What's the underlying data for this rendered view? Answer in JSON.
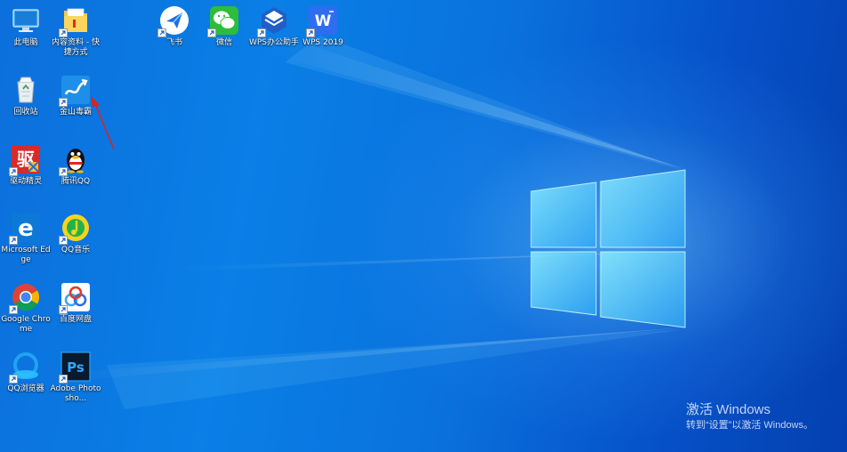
{
  "desktop": {
    "icons": {
      "this_pc": "此电脑",
      "internal_docs": "内容资料 - 快捷方式",
      "feishu": "飞书",
      "wechat": "微信",
      "wps_assistant": "WPS办公助手",
      "wps2019": "WPS 2019",
      "recycle_bin": "回收站",
      "kingsoft_av": "金山毒霸",
      "driver_genius": "驱动精灵",
      "tencent_qq": "腾讯QQ",
      "edge": "Microsoft Edge",
      "qq_music": "QQ音乐",
      "chrome": "Google Chrome",
      "baidu_netdisk": "百度网盘",
      "qq_browser": "QQ浏览器",
      "photoshop": "Adobe Photosho..."
    }
  },
  "watermark": {
    "title": "激活 Windows",
    "subtitle": "转到“设置”以激活 Windows。"
  },
  "colors": {
    "wallpaper_blue": "#0a7fe6",
    "logo_glow": "#7fe3ff",
    "arrow_red": "#e0201a"
  }
}
